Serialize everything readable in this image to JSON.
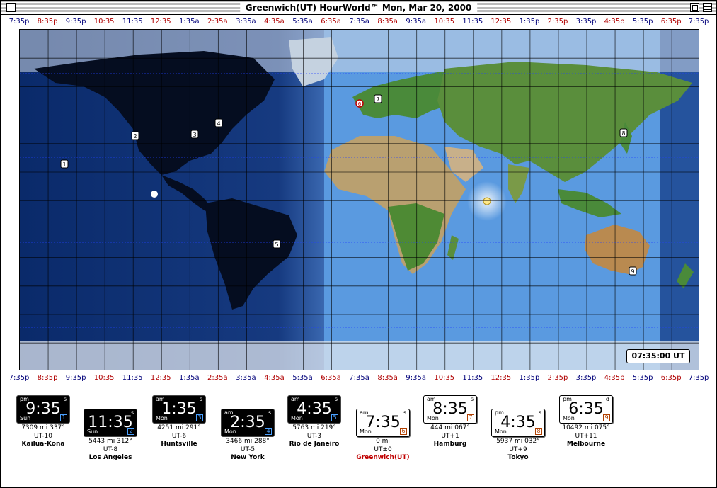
{
  "window": {
    "title": "Greenwich(UT)   HourWorld™   Mon, Mar 20, 2000"
  },
  "timescale": [
    {
      "label": "7:35p",
      "color": "blue"
    },
    {
      "label": "8:35p",
      "color": "red"
    },
    {
      "label": "9:35p",
      "color": "blue"
    },
    {
      "label": "10:35",
      "color": "red"
    },
    {
      "label": "11:35",
      "color": "blue"
    },
    {
      "label": "12:35",
      "color": "red"
    },
    {
      "label": "1:35a",
      "color": "blue"
    },
    {
      "label": "2:35a",
      "color": "red"
    },
    {
      "label": "3:35a",
      "color": "blue"
    },
    {
      "label": "4:35a",
      "color": "red"
    },
    {
      "label": "5:35a",
      "color": "blue"
    },
    {
      "label": "6:35a",
      "color": "red"
    },
    {
      "label": "7:35a",
      "color": "blue"
    },
    {
      "label": "8:35a",
      "color": "red"
    },
    {
      "label": "9:35a",
      "color": "blue"
    },
    {
      "label": "10:35",
      "color": "red"
    },
    {
      "label": "11:35",
      "color": "blue"
    },
    {
      "label": "12:35",
      "color": "red"
    },
    {
      "label": "1:35p",
      "color": "blue"
    },
    {
      "label": "2:35p",
      "color": "red"
    },
    {
      "label": "3:35p",
      "color": "blue"
    },
    {
      "label": "4:35p",
      "color": "red"
    },
    {
      "label": "5:35p",
      "color": "blue"
    },
    {
      "label": "6:35p",
      "color": "red"
    },
    {
      "label": "7:35p",
      "color": "blue"
    }
  ],
  "map": {
    "ut_time": "07:35:00 UT",
    "markers": [
      "1",
      "2",
      "3",
      "4",
      "5",
      "6",
      "7",
      "8",
      "9"
    ]
  },
  "clocks": [
    {
      "ampm": "pm",
      "flag": "s",
      "time": "9:35",
      "day": "Sun",
      "index": "1",
      "style": "dark",
      "distance": "7309 mi 337°",
      "offset": "UT-10",
      "city": "Kailua-Kona",
      "home": false
    },
    {
      "ampm": "",
      "flag": "s",
      "time": "11:35",
      "day": "Sun",
      "index": "2",
      "style": "dark",
      "distance": "5443 mi 312°",
      "offset": "UT-8",
      "city": "Los Angeles",
      "home": false
    },
    {
      "ampm": "am",
      "flag": "s",
      "time": "1:35",
      "day": "Mon",
      "index": "3",
      "style": "dark",
      "distance": "4251 mi 291°",
      "offset": "UT-6",
      "city": "Huntsville",
      "home": false
    },
    {
      "ampm": "am",
      "flag": "s",
      "time": "2:35",
      "day": "Mon",
      "index": "4",
      "style": "dark",
      "distance": "3466 mi 288°",
      "offset": "UT-5",
      "city": "New York",
      "home": false
    },
    {
      "ampm": "am",
      "flag": "s",
      "time": "4:35",
      "day": "Mon",
      "index": "5",
      "style": "dark",
      "distance": "5763 mi 219°",
      "offset": "UT-3",
      "city": "Rio de Janeiro",
      "home": false
    },
    {
      "ampm": "am",
      "flag": "s",
      "time": "7:35",
      "day": "Mon",
      "index": "6",
      "style": "light",
      "distance": "0 mi",
      "offset": "UT±0",
      "city": "Greenwich(UT)",
      "home": true
    },
    {
      "ampm": "am",
      "flag": "s",
      "time": "8:35",
      "day": "Mon",
      "index": "7",
      "style": "light",
      "distance": "444 mi 067°",
      "offset": "UT+1",
      "city": "Hamburg",
      "home": false
    },
    {
      "ampm": "pm",
      "flag": "s",
      "time": "4:35",
      "day": "Mon",
      "index": "8",
      "style": "light",
      "distance": "5937 mi 032°",
      "offset": "UT+9",
      "city": "Tokyo",
      "home": false
    },
    {
      "ampm": "pm",
      "flag": "d",
      "time": "6:35",
      "day": "Mon",
      "index": "9",
      "style": "light",
      "distance": "10492 mi 075°",
      "offset": "UT+11",
      "city": "Melbourne",
      "home": false
    }
  ]
}
